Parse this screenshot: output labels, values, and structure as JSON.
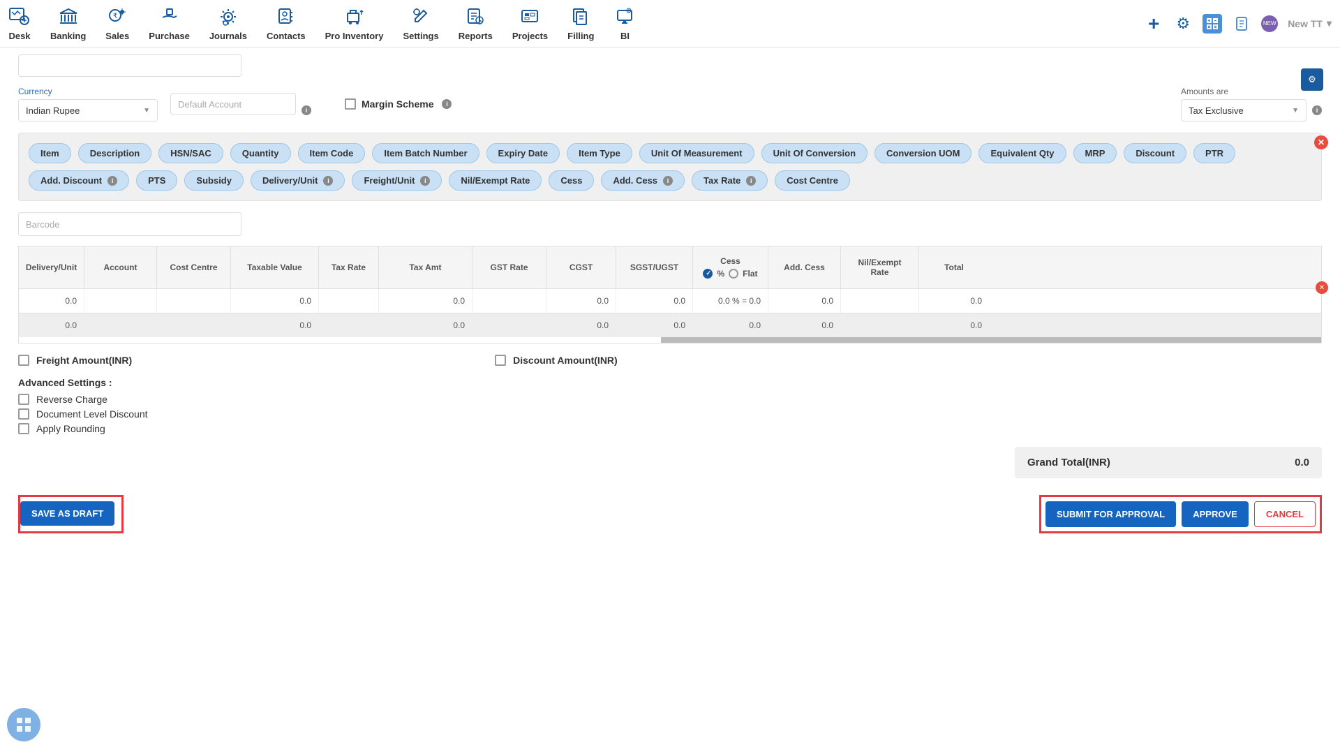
{
  "nav": {
    "items": [
      {
        "label": "Desk"
      },
      {
        "label": "Banking"
      },
      {
        "label": "Sales"
      },
      {
        "label": "Purchase"
      },
      {
        "label": "Journals"
      },
      {
        "label": "Contacts"
      },
      {
        "label": "Pro Inventory"
      },
      {
        "label": "Settings"
      },
      {
        "label": "Reports"
      },
      {
        "label": "Projects"
      },
      {
        "label": "Filling"
      },
      {
        "label": "BI"
      }
    ],
    "user_label": "New TT"
  },
  "form": {
    "currency_label": "Currency",
    "currency_value": "Indian Rupee",
    "default_account_placeholder": "Default Account",
    "margin_scheme": "Margin Scheme",
    "amounts_label": "Amounts are",
    "amounts_value": "Tax Exclusive",
    "barcode_placeholder": "Barcode"
  },
  "tags": [
    "Item",
    "Description",
    "HSN/SAC",
    "Quantity",
    "Item Code",
    "Item Batch Number",
    "Expiry Date",
    "Item Type",
    "Unit Of Measurement",
    "Unit Of Conversion",
    "Conversion UOM",
    "Equivalent Qty",
    "MRP",
    "Discount",
    "PTR",
    "Add. Discount",
    "PTS",
    "Subsidy",
    "Delivery/Unit",
    "Freight/Unit",
    "Nil/Exempt Rate",
    "Cess",
    "Add. Cess",
    "Tax Rate",
    "Cost Centre"
  ],
  "tag_info_indices": [
    15,
    18,
    19,
    22,
    23
  ],
  "table": {
    "headers": {
      "delivery_unit": "Delivery/Unit",
      "account": "Account",
      "cost_centre": "Cost Centre",
      "taxable_value": "Taxable Value",
      "tax_rate": "Tax Rate",
      "tax_amt": "Tax Amt",
      "gst_rate": "GST Rate",
      "cgst": "CGST",
      "sgst": "SGST/UGST",
      "cess": "Cess",
      "cess_pct": "%",
      "cess_flat": "Flat",
      "add_cess": "Add. Cess",
      "nil_exempt": "Nil/Exempt Rate",
      "total": "Total"
    },
    "row": {
      "delivery_unit": "0.0",
      "taxable_value": "0.0",
      "tax_amt": "0.0",
      "cgst": "0.0",
      "sgst": "0.0",
      "cess": "0.0 % = 0.0",
      "add_cess": "0.0",
      "total": "0.0"
    },
    "footer": {
      "delivery_unit": "0.0",
      "taxable_value": "0.0",
      "tax_amt": "0.0",
      "cgst": "0.0",
      "sgst": "0.0",
      "cess": "0.0",
      "add_cess": "0.0",
      "total": "0.0"
    }
  },
  "bottom": {
    "freight": "Freight Amount(INR)",
    "discount": "Discount Amount(INR)",
    "advanced_title": "Advanced Settings :",
    "reverse_charge": "Reverse Charge",
    "doc_discount": "Document Level Discount",
    "rounding": "Apply Rounding",
    "grand_total_label": "Grand Total(INR)",
    "grand_total_value": "0.0"
  },
  "actions": {
    "save_draft": "SAVE AS DRAFT",
    "submit": "SUBMIT FOR APPROVAL",
    "approve": "APPROVE",
    "cancel": "CANCEL"
  }
}
